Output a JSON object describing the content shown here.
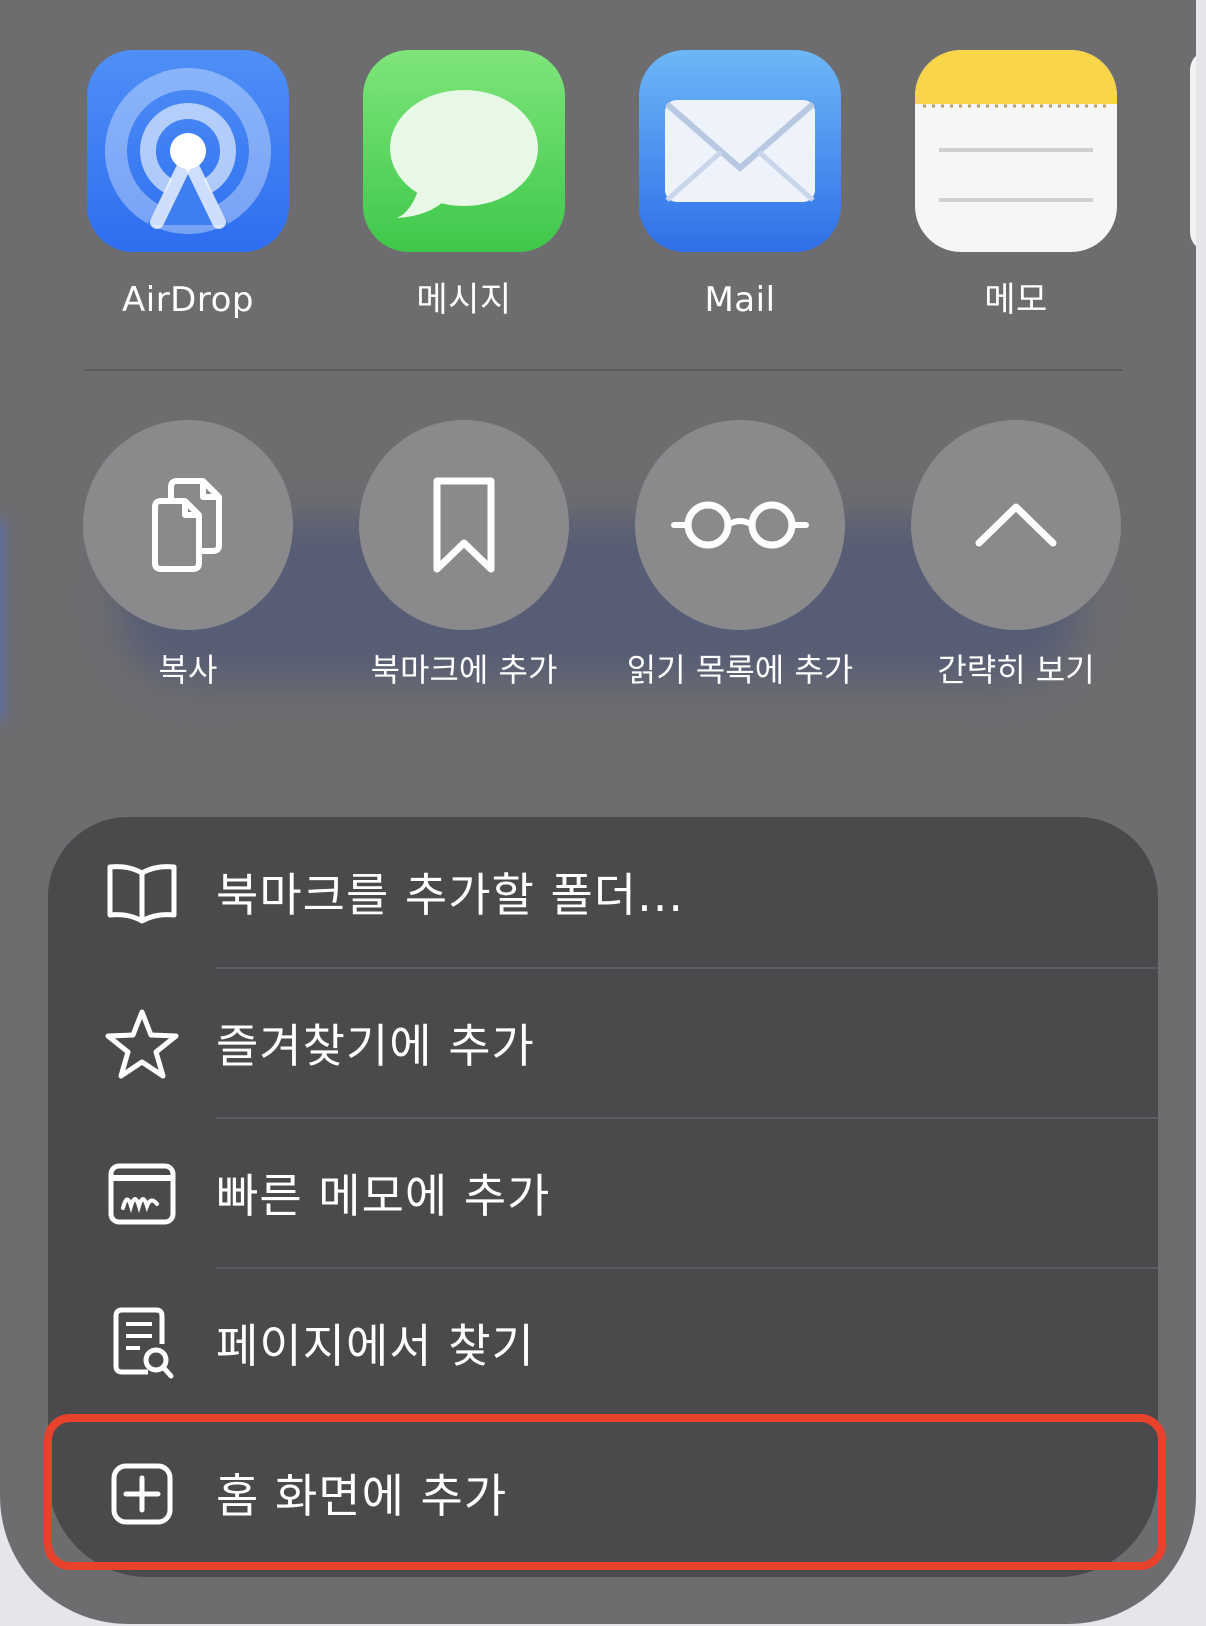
{
  "apps": [
    {
      "label": "AirDrop",
      "icon": "airdrop-icon"
    },
    {
      "label": "메시지",
      "icon": "messages-icon"
    },
    {
      "label": "Mail",
      "icon": "mail-icon"
    },
    {
      "label": "메모",
      "icon": "notes-icon"
    }
  ],
  "actions": [
    {
      "label": "복사",
      "icon": "copy-icon"
    },
    {
      "label": "북마크에 추가",
      "icon": "bookmark-icon"
    },
    {
      "label": "읽기 목록에 추가",
      "icon": "glasses-icon"
    },
    {
      "label": "간략히 보기",
      "icon": "chevron-up-icon"
    }
  ],
  "menu": [
    {
      "label": "북마크를 추가할 폴더...",
      "icon": "book-icon"
    },
    {
      "label": "즐겨찾기에 추가",
      "icon": "star-icon"
    },
    {
      "label": "빠른 메모에 추가",
      "icon": "quick-note-icon"
    },
    {
      "label": "페이지에서 찾기",
      "icon": "find-in-page-icon"
    },
    {
      "label": "홈 화면에 추가",
      "icon": "add-square-icon"
    }
  ],
  "colors": {
    "highlight": "#e8422c",
    "sheet": "#6d6d70",
    "menu": "#4a4a4d"
  }
}
